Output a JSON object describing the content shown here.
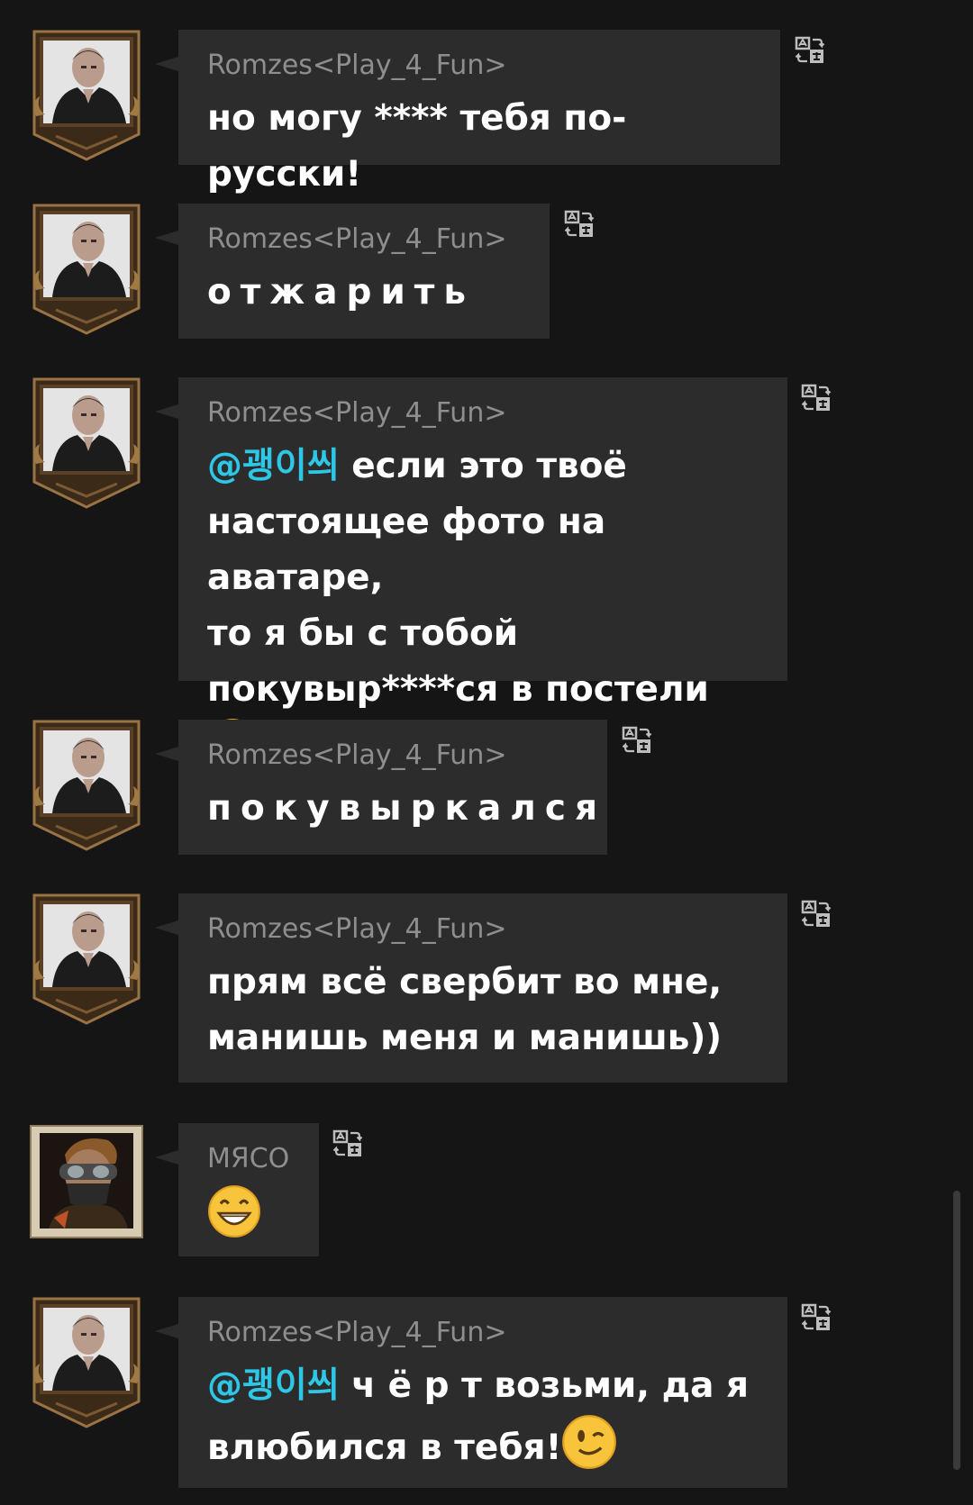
{
  "messages": [
    {
      "author": "Romzes<Play_4_Fun>",
      "avatar": "photo-avatar",
      "mention": "",
      "text": "но могу **** тебя по-русски!",
      "emoji": ""
    },
    {
      "author": "Romzes<Play_4_Fun>",
      "avatar": "photo-avatar",
      "mention": "",
      "text": "отжарить",
      "emoji": ""
    },
    {
      "author": "Romzes<Play_4_Fun>",
      "avatar": "photo-avatar",
      "mention": "@괭이씌",
      "text": " если это твоё\nнастоящее фото на аватаре,\nто я бы с тобой\nпокувыр****ся в постели",
      "emoji": "kissing-face-emoji"
    },
    {
      "author": "Romzes<Play_4_Fun>",
      "avatar": "photo-avatar",
      "mention": "",
      "text": "покувыркался",
      "emoji": ""
    },
    {
      "author": "Romzes<Play_4_Fun>",
      "avatar": "photo-avatar",
      "mention": "",
      "text": "прям всё свербит во мне,\nманишь меня и манишь))",
      "emoji": ""
    },
    {
      "author": "МЯСО",
      "avatar": "game-character-avatar",
      "mention": "",
      "text": "",
      "emoji": "grinning-face-emoji"
    },
    {
      "author": "Romzes<Play_4_Fun>",
      "avatar": "photo-avatar",
      "mention": "@괭이씌",
      "text": " ч ё р т возьми, да я\nвлюбился в тебя!",
      "emoji": "winking-face-emoji"
    }
  ],
  "colors": {
    "background": "#151515",
    "bubble": "#2c2c2c",
    "author": "#8e8e8e",
    "text": "#ffffff",
    "mention": "#2ec7e6"
  },
  "icons": {
    "translate": "translate-icon"
  }
}
